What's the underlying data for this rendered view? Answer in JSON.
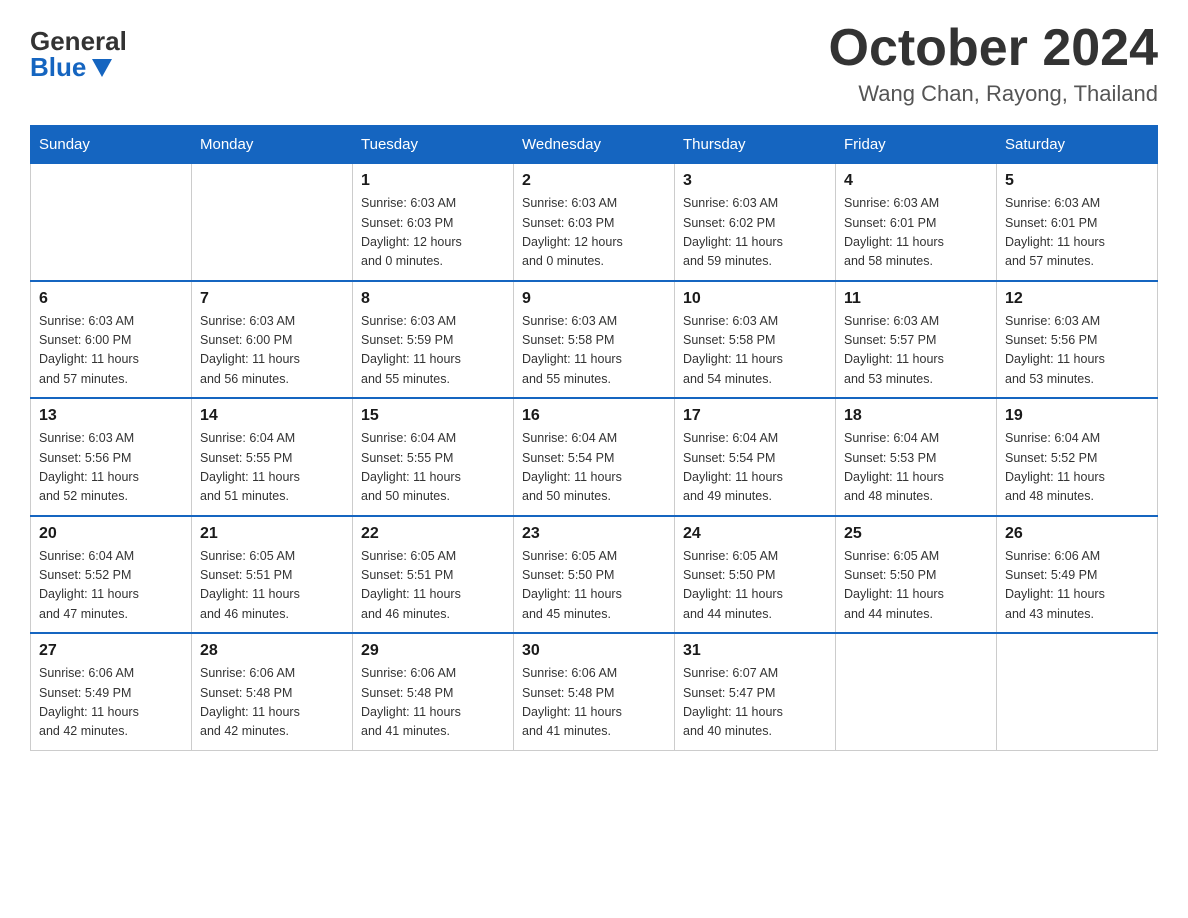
{
  "header": {
    "logo_general": "General",
    "logo_blue": "Blue",
    "month_title": "October 2024",
    "location": "Wang Chan, Rayong, Thailand"
  },
  "columns": [
    "Sunday",
    "Monday",
    "Tuesday",
    "Wednesday",
    "Thursday",
    "Friday",
    "Saturday"
  ],
  "weeks": [
    [
      {
        "day": "",
        "info": ""
      },
      {
        "day": "",
        "info": ""
      },
      {
        "day": "1",
        "info": "Sunrise: 6:03 AM\nSunset: 6:03 PM\nDaylight: 12 hours\nand 0 minutes."
      },
      {
        "day": "2",
        "info": "Sunrise: 6:03 AM\nSunset: 6:03 PM\nDaylight: 12 hours\nand 0 minutes."
      },
      {
        "day": "3",
        "info": "Sunrise: 6:03 AM\nSunset: 6:02 PM\nDaylight: 11 hours\nand 59 minutes."
      },
      {
        "day": "4",
        "info": "Sunrise: 6:03 AM\nSunset: 6:01 PM\nDaylight: 11 hours\nand 58 minutes."
      },
      {
        "day": "5",
        "info": "Sunrise: 6:03 AM\nSunset: 6:01 PM\nDaylight: 11 hours\nand 57 minutes."
      }
    ],
    [
      {
        "day": "6",
        "info": "Sunrise: 6:03 AM\nSunset: 6:00 PM\nDaylight: 11 hours\nand 57 minutes."
      },
      {
        "day": "7",
        "info": "Sunrise: 6:03 AM\nSunset: 6:00 PM\nDaylight: 11 hours\nand 56 minutes."
      },
      {
        "day": "8",
        "info": "Sunrise: 6:03 AM\nSunset: 5:59 PM\nDaylight: 11 hours\nand 55 minutes."
      },
      {
        "day": "9",
        "info": "Sunrise: 6:03 AM\nSunset: 5:58 PM\nDaylight: 11 hours\nand 55 minutes."
      },
      {
        "day": "10",
        "info": "Sunrise: 6:03 AM\nSunset: 5:58 PM\nDaylight: 11 hours\nand 54 minutes."
      },
      {
        "day": "11",
        "info": "Sunrise: 6:03 AM\nSunset: 5:57 PM\nDaylight: 11 hours\nand 53 minutes."
      },
      {
        "day": "12",
        "info": "Sunrise: 6:03 AM\nSunset: 5:56 PM\nDaylight: 11 hours\nand 53 minutes."
      }
    ],
    [
      {
        "day": "13",
        "info": "Sunrise: 6:03 AM\nSunset: 5:56 PM\nDaylight: 11 hours\nand 52 minutes."
      },
      {
        "day": "14",
        "info": "Sunrise: 6:04 AM\nSunset: 5:55 PM\nDaylight: 11 hours\nand 51 minutes."
      },
      {
        "day": "15",
        "info": "Sunrise: 6:04 AM\nSunset: 5:55 PM\nDaylight: 11 hours\nand 50 minutes."
      },
      {
        "day": "16",
        "info": "Sunrise: 6:04 AM\nSunset: 5:54 PM\nDaylight: 11 hours\nand 50 minutes."
      },
      {
        "day": "17",
        "info": "Sunrise: 6:04 AM\nSunset: 5:54 PM\nDaylight: 11 hours\nand 49 minutes."
      },
      {
        "day": "18",
        "info": "Sunrise: 6:04 AM\nSunset: 5:53 PM\nDaylight: 11 hours\nand 48 minutes."
      },
      {
        "day": "19",
        "info": "Sunrise: 6:04 AM\nSunset: 5:52 PM\nDaylight: 11 hours\nand 48 minutes."
      }
    ],
    [
      {
        "day": "20",
        "info": "Sunrise: 6:04 AM\nSunset: 5:52 PM\nDaylight: 11 hours\nand 47 minutes."
      },
      {
        "day": "21",
        "info": "Sunrise: 6:05 AM\nSunset: 5:51 PM\nDaylight: 11 hours\nand 46 minutes."
      },
      {
        "day": "22",
        "info": "Sunrise: 6:05 AM\nSunset: 5:51 PM\nDaylight: 11 hours\nand 46 minutes."
      },
      {
        "day": "23",
        "info": "Sunrise: 6:05 AM\nSunset: 5:50 PM\nDaylight: 11 hours\nand 45 minutes."
      },
      {
        "day": "24",
        "info": "Sunrise: 6:05 AM\nSunset: 5:50 PM\nDaylight: 11 hours\nand 44 minutes."
      },
      {
        "day": "25",
        "info": "Sunrise: 6:05 AM\nSunset: 5:50 PM\nDaylight: 11 hours\nand 44 minutes."
      },
      {
        "day": "26",
        "info": "Sunrise: 6:06 AM\nSunset: 5:49 PM\nDaylight: 11 hours\nand 43 minutes."
      }
    ],
    [
      {
        "day": "27",
        "info": "Sunrise: 6:06 AM\nSunset: 5:49 PM\nDaylight: 11 hours\nand 42 minutes."
      },
      {
        "day": "28",
        "info": "Sunrise: 6:06 AM\nSunset: 5:48 PM\nDaylight: 11 hours\nand 42 minutes."
      },
      {
        "day": "29",
        "info": "Sunrise: 6:06 AM\nSunset: 5:48 PM\nDaylight: 11 hours\nand 41 minutes."
      },
      {
        "day": "30",
        "info": "Sunrise: 6:06 AM\nSunset: 5:48 PM\nDaylight: 11 hours\nand 41 minutes."
      },
      {
        "day": "31",
        "info": "Sunrise: 6:07 AM\nSunset: 5:47 PM\nDaylight: 11 hours\nand 40 minutes."
      },
      {
        "day": "",
        "info": ""
      },
      {
        "day": "",
        "info": ""
      }
    ]
  ]
}
